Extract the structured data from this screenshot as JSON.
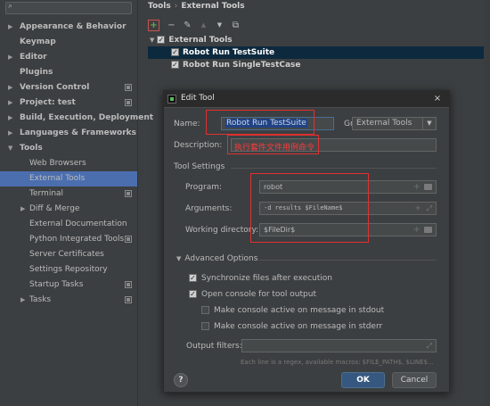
{
  "sidebar": {
    "items": [
      {
        "label": "Appearance & Behavior",
        "expand": "▶",
        "bold": true
      },
      {
        "label": "Keymap",
        "bold": true
      },
      {
        "label": "Editor",
        "expand": "▶",
        "bold": true
      },
      {
        "label": "Plugins",
        "bold": true
      },
      {
        "label": "Version Control",
        "expand": "▶",
        "bold": true,
        "project": true
      },
      {
        "label": "Project: test",
        "expand": "▶",
        "bold": true,
        "project": true
      },
      {
        "label": "Build, Execution, Deployment",
        "expand": "▶",
        "bold": true
      },
      {
        "label": "Languages & Frameworks",
        "expand": "▶",
        "bold": true
      },
      {
        "label": "Tools",
        "expand": "▼",
        "bold": true
      },
      {
        "label": "Web Browsers"
      },
      {
        "label": "External Tools",
        "selected": true
      },
      {
        "label": "Terminal",
        "project": true
      },
      {
        "label": "Diff & Merge",
        "expand": "▶"
      },
      {
        "label": "External Documentation"
      },
      {
        "label": "Python Integrated Tools",
        "project": true
      },
      {
        "label": "Server Certificates"
      },
      {
        "label": "Settings Repository"
      },
      {
        "label": "Startup Tasks",
        "project": true
      },
      {
        "label": "Tasks",
        "expand": "▶",
        "project": true
      }
    ]
  },
  "header": {
    "breadcrumb": [
      "Tools",
      "External Tools"
    ],
    "separator": "›"
  },
  "toolbar": {
    "add": "+",
    "remove": "−",
    "edit": "✎",
    "move_up": "▲",
    "move_down": "▼",
    "copy": "⧉"
  },
  "tools": {
    "group": {
      "label": "External Tools",
      "checked": true
    },
    "items": [
      {
        "label": "Robot Run TestSuite",
        "checked": true,
        "selected": true
      },
      {
        "label": "Robot Run SingleTestCase",
        "checked": true
      }
    ]
  },
  "dialog": {
    "title": "Edit Tool",
    "close": "×",
    "name_label": "Name:",
    "name_value": "Robot Run TestSuite",
    "group_label": "Group:",
    "group_value": "External Tools",
    "description_label": "Description:",
    "description_value": "",
    "annotation": "执行套件文件用例命令",
    "tool_settings_label": "Tool Settings",
    "program_label": "Program:",
    "program_value": "robot",
    "arguments_label": "Arguments:",
    "arguments_value": "-d results $FileName$",
    "working_dir_label": "Working directory:",
    "working_dir_value": "$FileDir$",
    "advanced_label": "Advanced Options",
    "advanced_arrow": "▼",
    "options": [
      {
        "label": "Synchronize files after execution",
        "checked": true
      },
      {
        "label": "Open console for tool output",
        "checked": true
      },
      {
        "label": "Make console active on message in stdout",
        "checked": false
      },
      {
        "label": "Make console active on message in stderr",
        "checked": false
      }
    ],
    "output_filters_label": "Output filters:",
    "output_filters_value": "",
    "hint": "Each line is a regex, available macros: $FILE_PATH$, $LINE$...",
    "help": "?",
    "ok": "OK",
    "cancel": "Cancel"
  },
  "glyphs": {
    "plus": "+",
    "check": "✓",
    "expand": "⤢",
    "dropdown": "▼"
  },
  "colors": {
    "accent": "#4b6eaf",
    "annotation": "#e03030",
    "background": "#3c3f41"
  }
}
